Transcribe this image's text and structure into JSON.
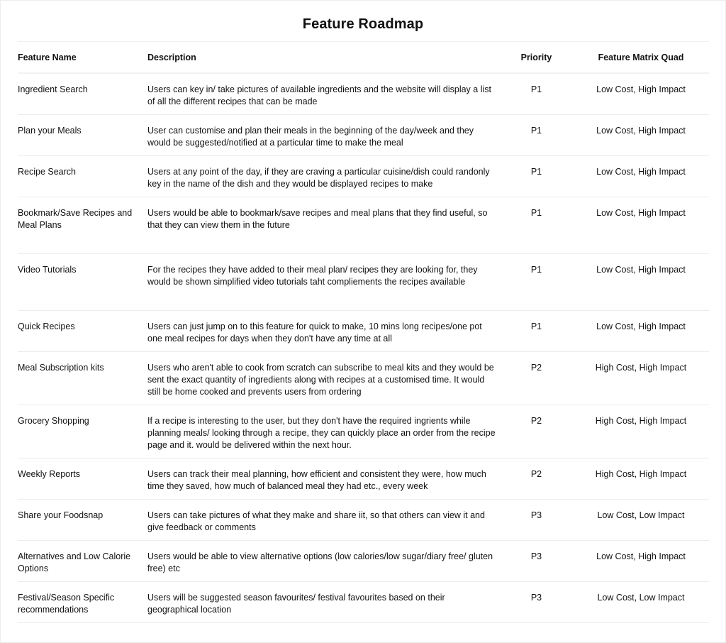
{
  "page": {
    "title": "Feature Roadmap"
  },
  "table": {
    "headers": {
      "name": "Feature Name",
      "description": "Description",
      "priority": "Priority",
      "quad": "Feature Matrix Quad"
    },
    "rows": [
      {
        "name": "Ingredient Search",
        "description": "Users can key in/ take pictures of available ingredients and the website will display a list of all the different recipes that can be made",
        "priority": "P1",
        "quad": "Low Cost, High Impact"
      },
      {
        "name": "Plan your Meals",
        "description": "User can customise and plan their meals in the beginning of the day/week and they would be suggested/notified at a particular time to make the meal",
        "priority": "P1",
        "quad": "Low Cost, High Impact"
      },
      {
        "name": "Recipe Search",
        "description": "Users at any point of the day, if they are craving a particular cuisine/dish could randonly key in the name of the dish and they would be displayed recipes to make",
        "priority": "P1",
        "quad": "Low Cost, High Impact"
      },
      {
        "name": "Bookmark/Save Recipes and Meal Plans",
        "description": "Users would be able to bookmark/save recipes and meal plans that they find useful, so that they can view them in the future",
        "priority": "P1",
        "quad": "Low Cost, High Impact"
      },
      {
        "name": "Video Tutorials",
        "description": "For the recipes they have added to their meal plan/ recipes they are looking for, they would be shown simplified video tutorials taht compliements the recipes available",
        "priority": "P1",
        "quad": "Low Cost, High Impact"
      },
      {
        "name": "Quick Recipes",
        "description": "Users can just jump on to this feature for quick to make, 10 mins long recipes/one pot one meal recipes for days when they don't have any time at all",
        "priority": "P1",
        "quad": "Low Cost, High Impact"
      },
      {
        "name": "Meal Subscription kits",
        "description": "Users who aren't able to cook from scratch can subscribe to meal kits and they would be sent the exact quantity of ingredients along with recipes at a customised time. It would still be home cooked and prevents users from ordering",
        "priority": "P2",
        "quad": "High Cost, High Impact"
      },
      {
        "name": "Grocery Shopping",
        "description": "If a recipe is interesting to the user, but they don't have the required ingrients while planning meals/ looking through a recipe, they can quickly place an order from the recipe page and it. would be delivered within the next hour.",
        "priority": "P2",
        "quad": "High Cost, High Impact"
      },
      {
        "name": "Weekly Reports",
        "description": "Users can track their meal planning, how efficient and consistent they were, how much time they saved, how much of balanced meal they had etc., every week",
        "priority": "P2",
        "quad": "High Cost, High Impact"
      },
      {
        "name": "Share your Foodsnap",
        "description": "Users can take pictures of what they make and share iit, so that others can view it and give feedback or comments",
        "priority": "P3",
        "quad": "Low Cost, Low Impact"
      },
      {
        "name": "Alternatives and Low Calorie Options",
        "description": "Users would be able to view alternative options (low calories/low sugar/diary free/ gluten free) etc",
        "priority": "P3",
        "quad": "Low Cost, High Impact"
      },
      {
        "name": "Festival/Season Specific recommendations",
        "description": "Users will be suggested season favourites/ festival favourites based on their geographical location",
        "priority": "P3",
        "quad": "Low Cost, Low Impact"
      }
    ]
  }
}
